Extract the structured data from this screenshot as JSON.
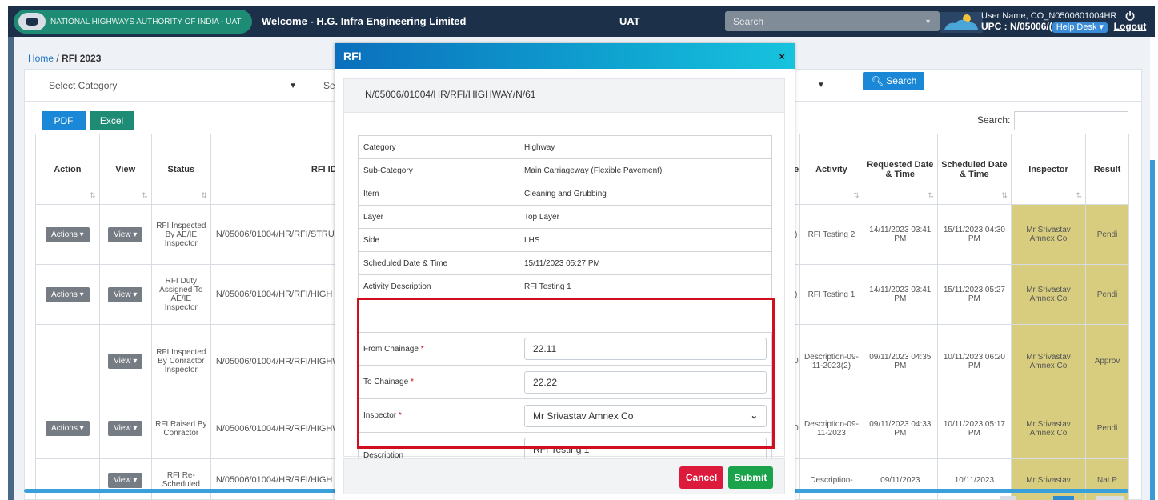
{
  "navbar": {
    "brand": "NATIONAL HIGHWAYS AUTHORITY OF INDIA - UAT",
    "welcome": "Welcome - H.G. Infra Engineering Limited",
    "env": "UAT",
    "search_placeholder": "Search",
    "user_name": "User Name, CO_N0500601004HR",
    "upc": "UPC : N/05006/(",
    "help_desk": "Help Desk",
    "logout": "Logout"
  },
  "breadcrumb": {
    "home": "Home",
    "current": "RFI 2023"
  },
  "filters": {
    "category_placeholder": "Select Category",
    "second_select": "Se",
    "search_button": "Search"
  },
  "table": {
    "pdf": "PDF",
    "excel": "Excel",
    "search_label": "Search:",
    "headers": {
      "action": "Action",
      "view": "View",
      "status": "Status",
      "rfi_id": "RFI ID",
      "activity": "Activity",
      "requested": "Requested Date & Time",
      "scheduled": "Scheduled Date & Time",
      "inspector": "Inspector",
      "result": "Result"
    },
    "rows": [
      {
        "action": "Actions",
        "view": "View",
        "status": "RFI Inspected By AE/IE Inspector",
        "rfi_id": "N/05006/01004/HR/RFI/STRUC",
        "sd": ")",
        "activity": "RFI Testing 2",
        "requested": "14/11/2023 03:41 PM",
        "scheduled": "15/11/2023 04:30 PM",
        "inspector": "Mr Srivastav Amnex Co",
        "result": "Pendi"
      },
      {
        "action": "Actions",
        "view": "View",
        "status": "RFI Duty Assigned To AE/IE Inspector",
        "rfi_id": "N/05006/01004/HR/RFI/HIGH",
        "sd": ")",
        "activity": "RFI Testing 1",
        "requested": "14/11/2023 03:41 PM",
        "scheduled": "15/11/2023 05:27 PM",
        "inspector": "Mr Srivastav Amnex Co",
        "result": "Pendi"
      },
      {
        "action": "",
        "view": "View",
        "status": "RFI Inspected By Conractor Inspector",
        "rfi_id": "N/05006/01004/HR/RFI/HIGHW",
        "sd": "0",
        "activity": "Description-09-11-2023(2)",
        "requested": "09/11/2023 04:35 PM",
        "scheduled": "10/11/2023 06:20 PM",
        "inspector": "Mr Srivastav Amnex Co",
        "result": "Approv"
      },
      {
        "action": "Actions",
        "view": "View",
        "status": "RFI Raised By Conractor",
        "rfi_id": "N/05006/01004/HR/RFI/HIGHW",
        "sd": "0",
        "activity": "Description-09-11-2023",
        "requested": "09/11/2023 04:33 PM",
        "scheduled": "10/11/2023 05:17 PM",
        "inspector": "Mr Srivastav Amnex Co",
        "result": "Pendi"
      },
      {
        "action": "",
        "view": "View",
        "status": "RFI Re-Scheduled",
        "rfi_id": "N/05006/01004/HR/RFI/HIGH",
        "sd": "",
        "activity": "Description-",
        "requested": "09/11/2023",
        "scheduled": "10/11/2023",
        "inspector": "Mr Srivastav",
        "result": "Nat P"
      }
    ]
  },
  "modal": {
    "title": "RFI",
    "close": "×",
    "rfi_number": "N/05006/01004/HR/RFI/HIGHWAY/N/61",
    "details": [
      {
        "label": "Category",
        "value": "Highway"
      },
      {
        "label": "Sub-Category",
        "value": "Main Carriageway (Flexible Pavement)"
      },
      {
        "label": "Item",
        "value": "Cleaning and Grubbing"
      },
      {
        "label": "Layer",
        "value": "Top Layer"
      },
      {
        "label": "Side",
        "value": "LHS"
      },
      {
        "label": "Scheduled Date & Time",
        "value": "15/11/2023 05:27 PM"
      },
      {
        "label": "Activity Description",
        "value": "RFI Testing 1"
      }
    ],
    "form": {
      "from_chainage_label": "From Chainage",
      "from_chainage_value": "22.11",
      "to_chainage_label": "To Chainage",
      "to_chainage_value": "22.22",
      "inspector_label": "Inspector",
      "inspector_value": "Mr Srivastav Amnex Co",
      "description_label": "Description",
      "description_value": "RFI Testing 1",
      "required_mark": "*"
    },
    "cancel": "Cancel",
    "submit": "Submit"
  }
}
